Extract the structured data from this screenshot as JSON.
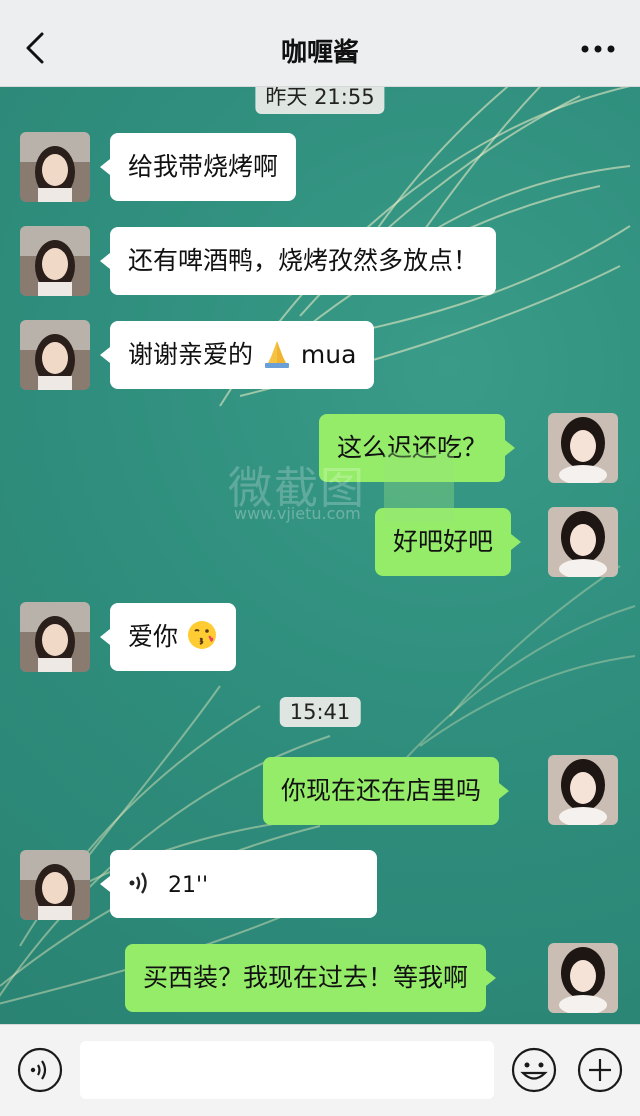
{
  "header": {
    "title": "咖喱酱",
    "back_icon": "chevron-left-icon",
    "more_icon": "more-dots-icon"
  },
  "chat": {
    "timestamps": [
      "昨天 21:55",
      "15:41"
    ],
    "messages": [
      {
        "side": "in",
        "type": "text",
        "text": "给我带烧烤啊"
      },
      {
        "side": "in",
        "type": "text",
        "text": "还有啤酒鸭，烧烤孜然多放点！"
      },
      {
        "side": "in",
        "type": "text",
        "text": "谢谢亲爱的",
        "suffix": "mua",
        "emoji": "folded-hands"
      },
      {
        "side": "out",
        "type": "text",
        "text": "这么迟还吃？"
      },
      {
        "side": "out",
        "type": "text",
        "text": "好吧好吧"
      },
      {
        "side": "in",
        "type": "text",
        "text": "爱你",
        "emoji": "kissing-face"
      },
      {
        "side": "out",
        "type": "text",
        "text": "你现在还在店里吗"
      },
      {
        "side": "in",
        "type": "voice",
        "text": "21''"
      },
      {
        "side": "out",
        "type": "text",
        "text": "买西装？我现在过去！等我啊"
      }
    ]
  },
  "watermark": {
    "text": "微截图",
    "url": "www.vjietu.com"
  },
  "input_bar": {
    "voice_icon": "voice-icon",
    "emoji_icon": "emoji-icon",
    "plus_icon": "plus-icon",
    "placeholder": ""
  },
  "colors": {
    "nav_bg": "#eceef0",
    "chat_bg": "#2e8d7c",
    "bubble_in": "#ffffff",
    "bubble_out": "#95ec69",
    "input_bar_bg": "#f3f3f3"
  }
}
